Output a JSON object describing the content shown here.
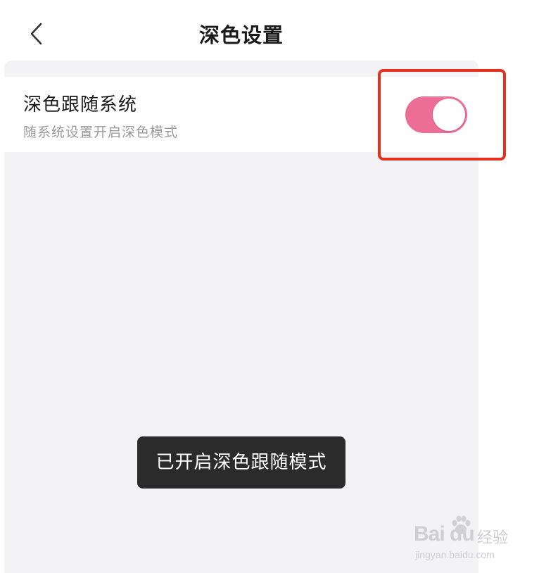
{
  "header": {
    "title": "深色设置",
    "back_icon": "chevron-left-icon"
  },
  "setting": {
    "title": "深色跟随系统",
    "subtitle": "随系统设置开启深色模式",
    "toggle_state": "on",
    "toggle_color": "#ec6d96"
  },
  "toast": {
    "message": "已开启深色跟随模式"
  },
  "annotation": {
    "color": "#e6301f"
  },
  "watermark": {
    "logo": "Bai du",
    "label": "经验",
    "url": "jingyan.baidu.com"
  }
}
